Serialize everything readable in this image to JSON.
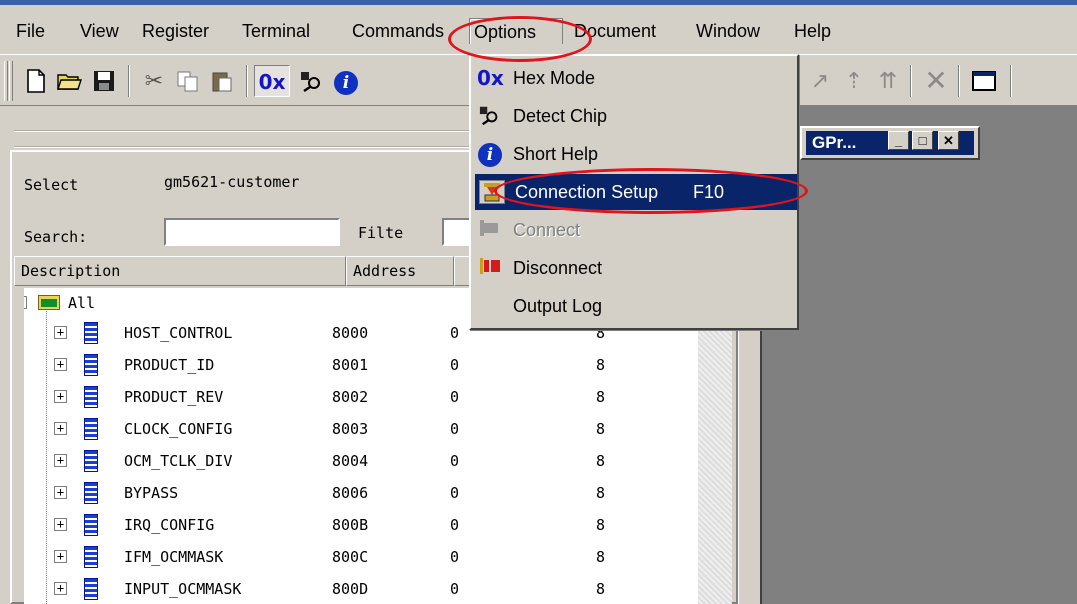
{
  "menubar": {
    "items": [
      "File",
      "View",
      "Register",
      "Terminal",
      "Commands",
      "Options",
      "Document",
      "Window",
      "Help"
    ]
  },
  "toolbar": {
    "hex_icon_text": "0x",
    "info_icon_text": "i",
    "icons": [
      "new-file-icon",
      "open-folder-icon",
      "save-disk-icon",
      "cut-icon",
      "copy-icon",
      "paste-icon",
      "hex-mode-icon",
      "detect-chip-icon",
      "info-icon",
      "write-arrow-icon",
      "read-arrow-icon",
      "up-arrows-icon",
      "delete-icon",
      "window-icon"
    ]
  },
  "options_menu": {
    "items": [
      {
        "label": "Hex Mode",
        "icon": "hex-mode-icon",
        "icon_text": "0x"
      },
      {
        "label": "Detect Chip",
        "icon": "detect-chip-icon"
      },
      {
        "label": "Short Help",
        "icon": "info-icon",
        "icon_text": "i"
      },
      {
        "label": "Connection Setup",
        "shortcut": "F10",
        "icon": "connection-setup-icon",
        "highlighted": true
      },
      {
        "label": "Connect",
        "icon": "connect-plug-icon",
        "disabled": true
      },
      {
        "label": "Disconnect",
        "icon": "disconnect-plug-icon"
      },
      {
        "label": "Output Log"
      }
    ]
  },
  "child_window": {
    "title": "GPr..."
  },
  "register_panel": {
    "select_label": "Select",
    "select_value": "gm5621-customer",
    "search_label": "Search:",
    "search_value": "",
    "filter_label": "Filte",
    "filter_value": "",
    "columns": [
      "Description",
      "Address"
    ],
    "root_item": "All",
    "rows": [
      {
        "name": "HOST_CONTROL",
        "address": "8000",
        "c3": "0",
        "c4": "8"
      },
      {
        "name": "PRODUCT_ID",
        "address": "8001",
        "c3": "0",
        "c4": "8"
      },
      {
        "name": "PRODUCT_REV",
        "address": "8002",
        "c3": "0",
        "c4": "8"
      },
      {
        "name": "CLOCK_CONFIG",
        "address": "8003",
        "c3": "0",
        "c4": "8"
      },
      {
        "name": "OCM_TCLK_DIV",
        "address": "8004",
        "c3": "0",
        "c4": "8"
      },
      {
        "name": "BYPASS",
        "address": "8006",
        "c3": "0",
        "c4": "8"
      },
      {
        "name": "IRQ_CONFIG",
        "address": "800B",
        "c3": "0",
        "c4": "8"
      },
      {
        "name": "IFM_OCMMASK",
        "address": "800C",
        "c3": "0",
        "c4": "8"
      },
      {
        "name": "INPUT_OCMMASK",
        "address": "800D",
        "c3": "0",
        "c4": "8"
      }
    ]
  },
  "colors": {
    "highlight": "#0a246a",
    "annotation": "#e0141c",
    "face": "#d4d0c8"
  }
}
